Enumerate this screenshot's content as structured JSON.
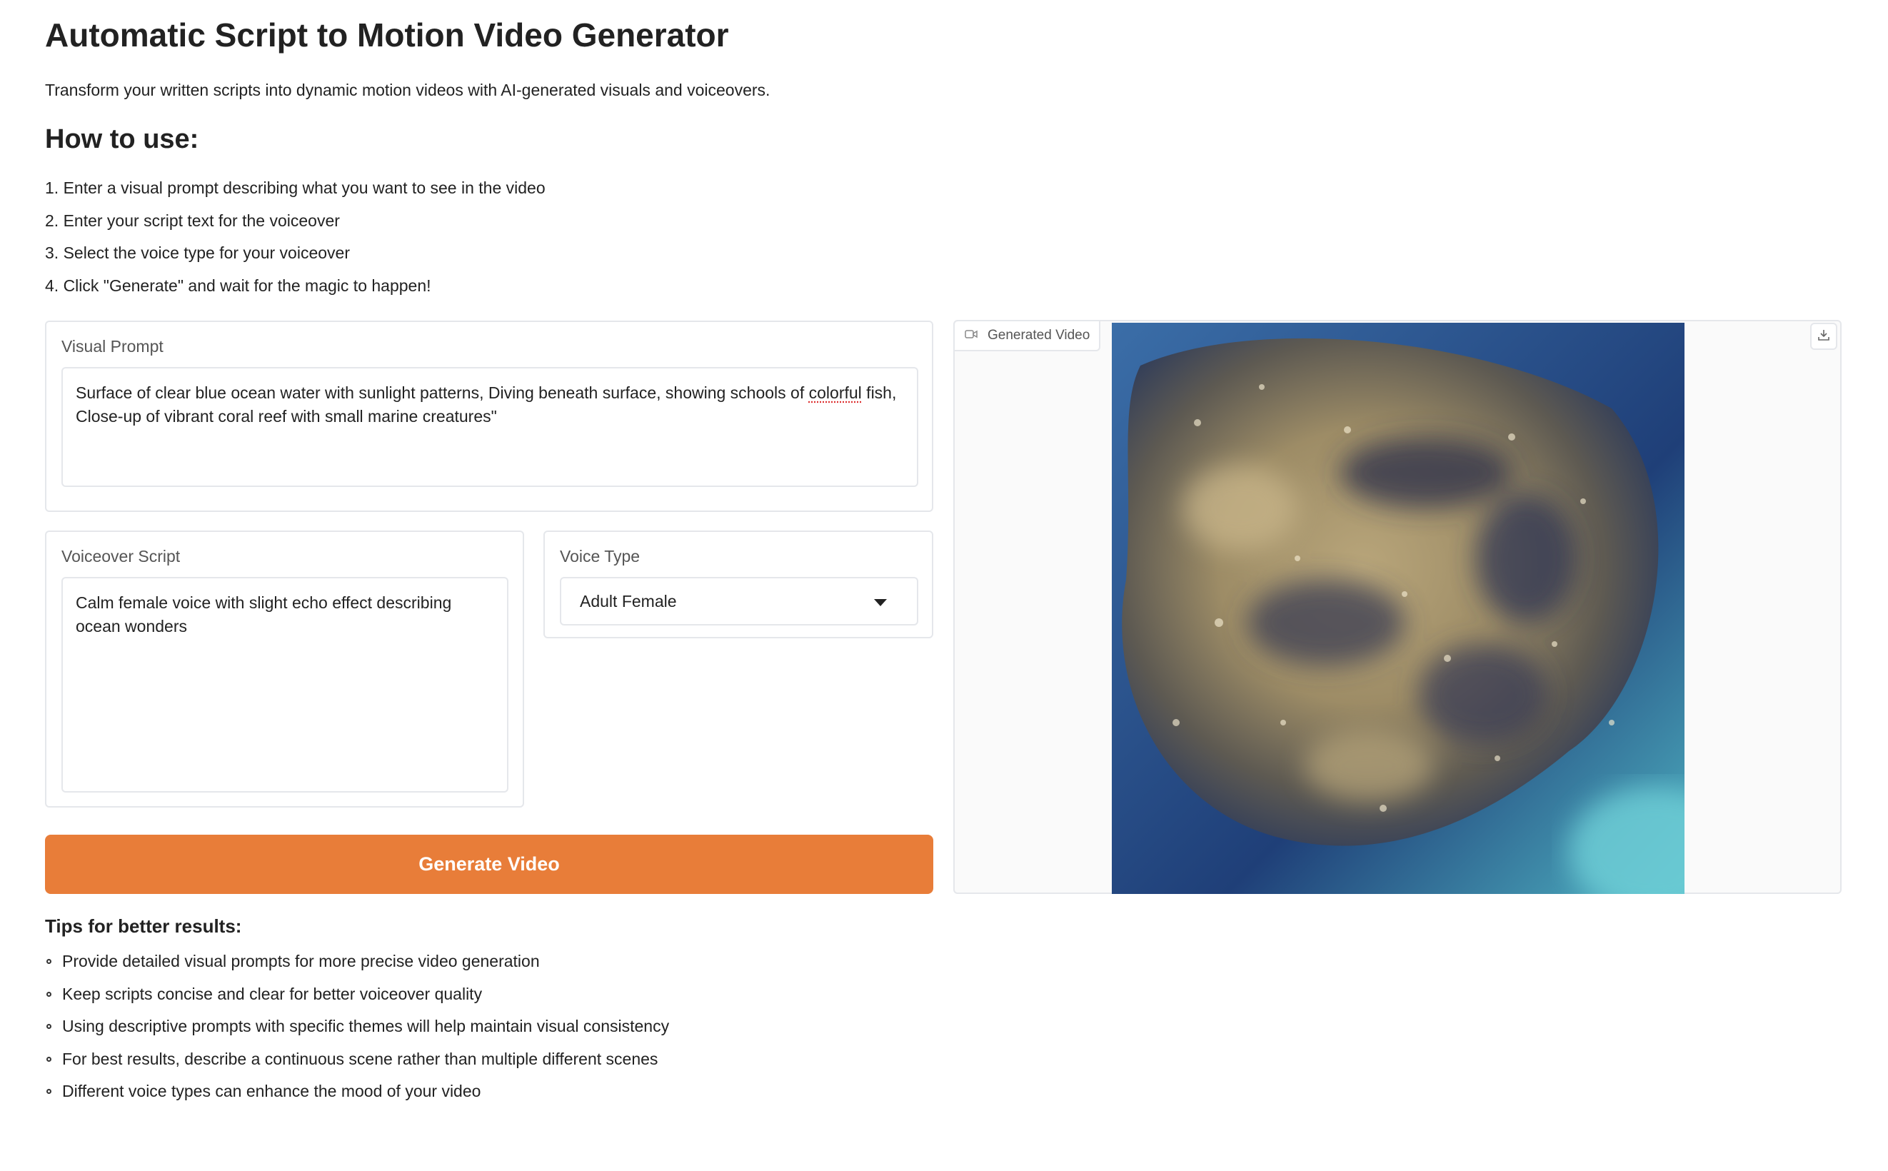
{
  "header": {
    "title": "Automatic Script to Motion Video Generator",
    "description": "Transform your written scripts into dynamic motion videos with AI-generated visuals and voiceovers."
  },
  "how_to": {
    "heading": "How to use:",
    "steps": [
      "1. Enter a visual prompt describing what you want to see in the video",
      "2. Enter your script text for the voiceover",
      "3. Select the voice type for your voiceover",
      "4. Click \"Generate\" and wait for the magic to happen!"
    ]
  },
  "visual_prompt": {
    "label": "Visual Prompt",
    "value": "Surface of clear blue ocean water with sunlight patterns, Diving beneath surface, showing schools of colorful fish, Close-up of vibrant coral reef with small marine creatures\""
  },
  "voiceover_script": {
    "label": "Voiceover Script",
    "value": "Calm female voice with slight echo effect describing ocean wonders"
  },
  "voice_type": {
    "label": "Voice Type",
    "selected": "Adult Female"
  },
  "generate_button": {
    "label": "Generate Video"
  },
  "output": {
    "label": "Generated Video",
    "camera_icon": "video-camera-icon",
    "download_icon": "download-icon"
  },
  "tips": {
    "heading": "Tips for better results:",
    "items": [
      "Provide detailed visual prompts for more precise video generation",
      "Keep scripts concise and clear for better voiceover quality",
      "Using descriptive prompts with specific themes will help maintain visual consistency",
      "For best results, describe a continuous scene rather than multiple different scenes",
      "Different voice types can enhance the mood of your video"
    ]
  },
  "colors": {
    "accent": "#e87d39",
    "border": "#e5e7eb",
    "text": "#222222",
    "label": "#555555"
  }
}
